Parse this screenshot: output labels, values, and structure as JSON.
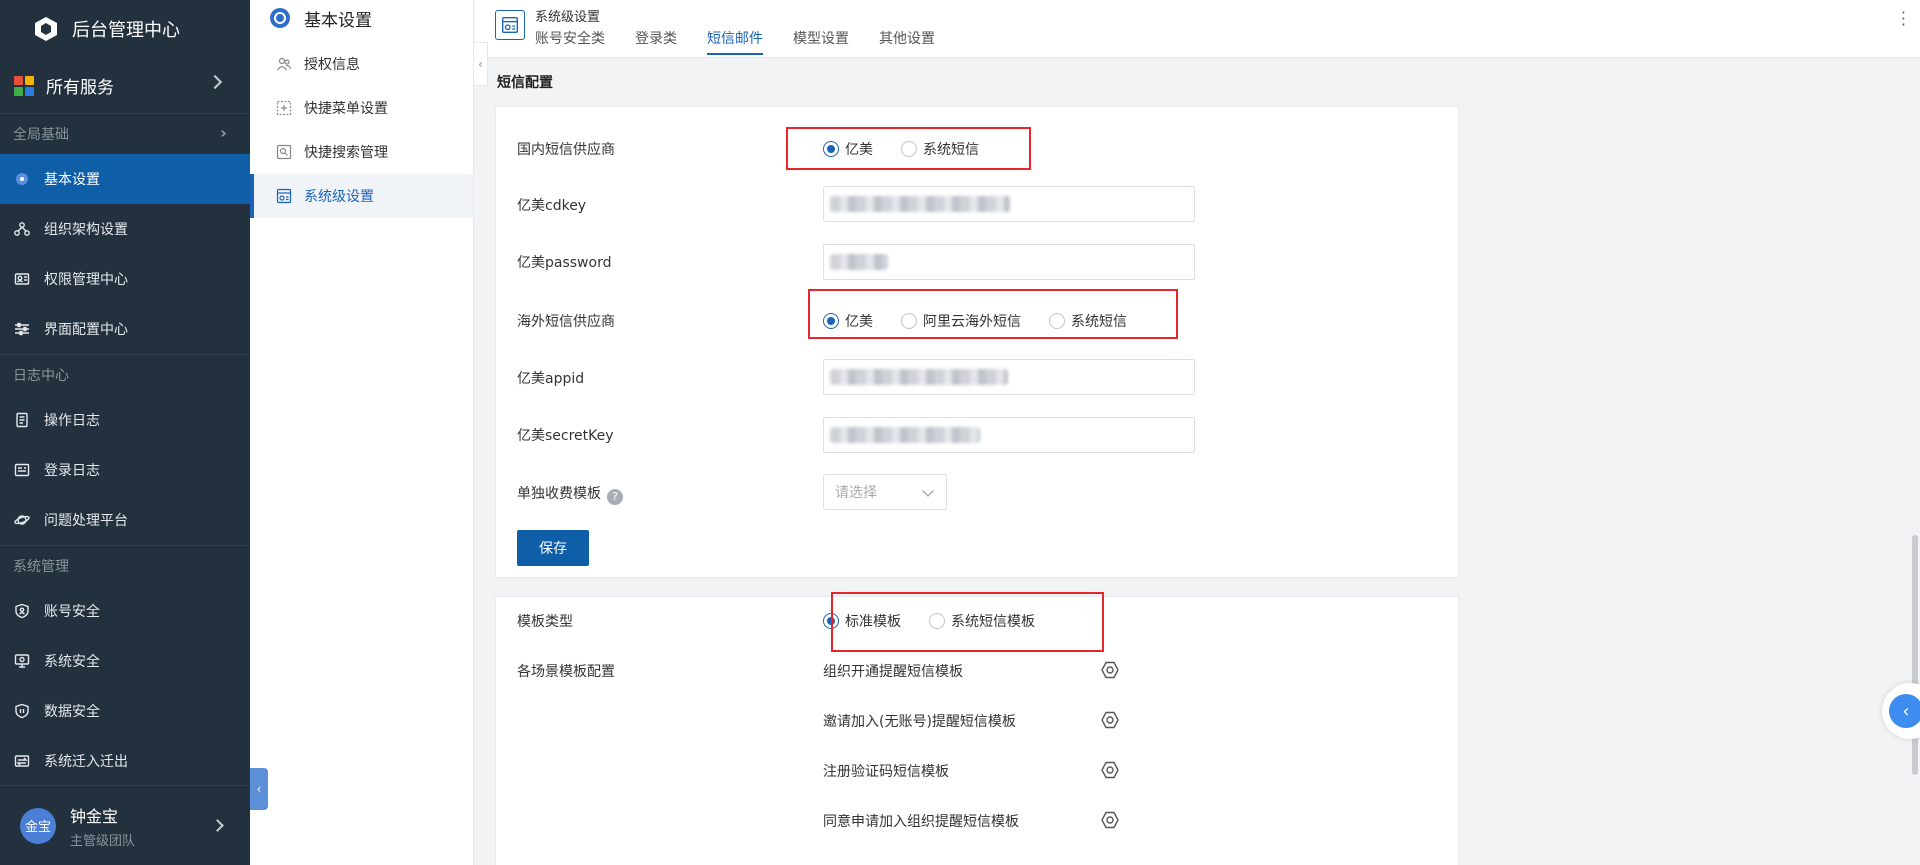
{
  "app": {
    "title": "后台管理中心",
    "all_services": "所有服务"
  },
  "sidebar": {
    "groups": [
      {
        "title": "全局基础",
        "items": [
          {
            "label": "基本设置",
            "icon": "settings-dot-icon",
            "active": true
          },
          {
            "label": "组织架构设置",
            "icon": "org-tree-icon"
          },
          {
            "label": "权限管理中心",
            "icon": "permission-icon"
          },
          {
            "label": "界面配置中心",
            "icon": "sliders-icon"
          }
        ]
      },
      {
        "title": "日志中心",
        "items": [
          {
            "label": "操作日志",
            "icon": "doc-icon"
          },
          {
            "label": "登录日志",
            "icon": "login-log-icon"
          },
          {
            "label": "问题处理平台",
            "icon": "planet-icon"
          }
        ]
      },
      {
        "title": "系统管理",
        "items": [
          {
            "label": "账号安全",
            "icon": "shield-user-icon"
          },
          {
            "label": "系统安全",
            "icon": "monitor-shield-icon"
          },
          {
            "label": "数据安全",
            "icon": "shield-icon"
          },
          {
            "label": "系统迁入迁出",
            "icon": "transfer-icon"
          }
        ]
      }
    ],
    "user": {
      "avatar": "金宝",
      "name": "钟金宝",
      "role": "主管级团队"
    }
  },
  "submenu": {
    "title": "基本设置",
    "items": [
      {
        "label": "授权信息",
        "icon": "people-icon"
      },
      {
        "label": "快捷菜单设置",
        "icon": "shortcut-icon"
      },
      {
        "label": "快捷搜索管理",
        "icon": "search-manage-icon"
      },
      {
        "label": "系统级设置",
        "icon": "system-settings-icon",
        "active": true
      }
    ]
  },
  "page": {
    "title": "系统级设置",
    "tabs": [
      "账号安全类",
      "登录类",
      "短信邮件",
      "模型设置",
      "其他设置"
    ],
    "active_tab": "短信邮件"
  },
  "sms": {
    "section_title": "短信配置",
    "domestic_label": "国内短信供应商",
    "domestic_options": [
      "亿美",
      "系统短信"
    ],
    "domestic_selected": "亿美",
    "cdkey_label": "亿美cdkey",
    "password_label": "亿美password",
    "overseas_label": "海外短信供应商",
    "overseas_options": [
      "亿美",
      "阿里云海外短信",
      "系统短信"
    ],
    "overseas_selected": "亿美",
    "appid_label": "亿美appid",
    "secret_label": "亿美secretKey",
    "fee_template_label": "单独收费模板",
    "fee_template_placeholder": "请选择",
    "save_label": "保存"
  },
  "templates": {
    "type_label": "模板类型",
    "type_options": [
      "标准模板",
      "系统短信模板"
    ],
    "type_selected": "标准模板",
    "scene_label": "各场景模板配置",
    "scene_items": [
      "组织开通提醒短信模板",
      "邀请加入(无账号)提醒短信模板",
      "注册验证码短信模板",
      "同意申请加入组织提醒短信模板"
    ]
  },
  "colors": {
    "sidebar_bg": "#23303e",
    "accent": "#0e5ea8",
    "highlight": "#e5262b"
  }
}
